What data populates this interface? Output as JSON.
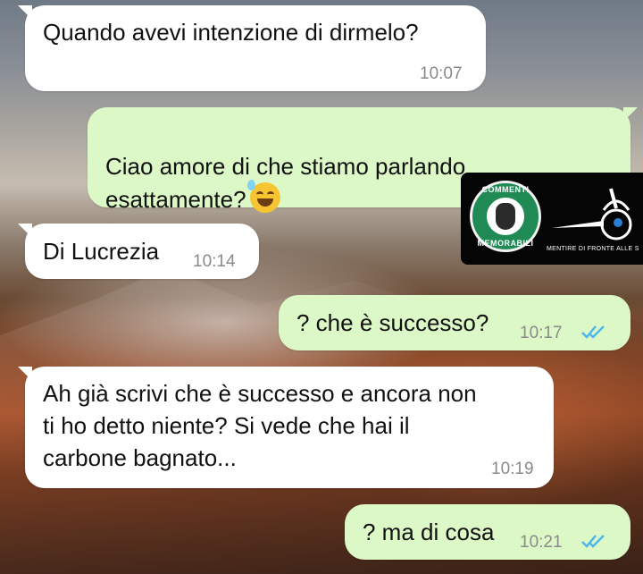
{
  "chat": {
    "messages": [
      {
        "direction": "incoming",
        "text": "Quando avevi intenzione di dirmelo?",
        "time": "10:07"
      },
      {
        "direction": "outgoing",
        "text": "Ciao amore di che stiamo parlando\nesattamente?",
        "emoji": "sweat-smile-emoji",
        "time": ""
      },
      {
        "direction": "incoming",
        "text": "Di Lucrezia",
        "time": "10:14"
      },
      {
        "direction": "outgoing",
        "text": "? che è successo?",
        "time": "10:17",
        "status": "read"
      },
      {
        "direction": "incoming",
        "text": "Ah già scrivi che è successo e ancora non\nti ho detto niente? Si vede che hai il\ncarbone bagnato...",
        "time": "10:19"
      },
      {
        "direction": "outgoing",
        "text": "? ma di cosa",
        "time": "10:21",
        "status": "read"
      }
    ]
  },
  "watermark": {
    "seal_top": "COMMENTI",
    "seal_bottom": "MEMORABILI",
    "caption": "MENTIRE DI FRONTE ALLE SPUNTE BLU"
  },
  "colors": {
    "incoming_bubble": "#ffffff",
    "outgoing_bubble": "#dcf8c6",
    "read_ticks": "#4fb6ec",
    "time_text": "#8a8a8a"
  }
}
